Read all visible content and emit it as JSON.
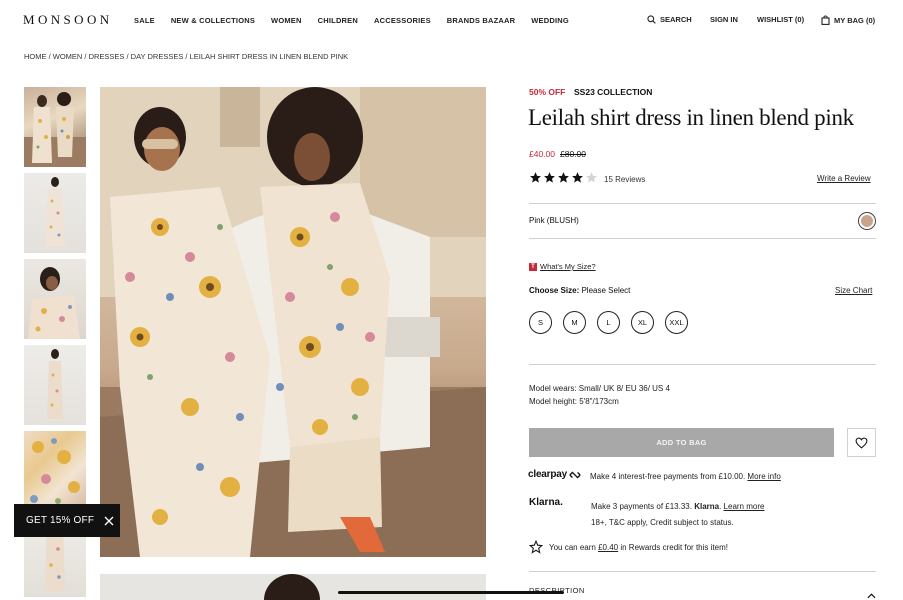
{
  "header": {
    "logo": "MONSOON",
    "nav": [
      "SALE",
      "NEW & COLLECTIONS",
      "WOMEN",
      "CHILDREN",
      "ACCESSORIES",
      "BRANDS BAZAAR",
      "WEDDING"
    ],
    "search": "SEARCH",
    "sign_in": "SIGN IN",
    "wishlist": "WISHLIST (0)",
    "bag": "MY BAG (0)"
  },
  "breadcrumb": "HOME / WOMEN / DRESSES / DAY DRESSES / LEILAH SHIRT DRESS IN LINEN BLEND PINK",
  "product": {
    "discount": "50% OFF",
    "collection": "SS23 COLLECTION",
    "title": "Leilah shirt dress in linen blend pink",
    "price_now": "£40.00",
    "price_was": "£80.00",
    "rating": 4,
    "rating_max": 5,
    "reviews": "15 Reviews",
    "write_review": "Write a Review",
    "color_label": "Pink (BLUSH)",
    "swatch_color": "#c9a48b",
    "whats_my_size": "What's My Size?",
    "size_badge": "T",
    "choose_size_label": "Choose Size:",
    "choose_size_value": "Please Select",
    "size_chart": "Size Chart",
    "sizes": [
      "S",
      "M",
      "L",
      "XL",
      "XXL"
    ],
    "model_wears": "Model wears: Small/ UK 8/ EU 36/ US 4",
    "model_height": "Model height: 5'8\"/173cm",
    "add_to_bag": "ADD TO BAG",
    "clearpay_logo": "clearpay",
    "clearpay_text": "Make 4 interest-free payments from £10.00.",
    "clearpay_more": "More info",
    "klarna_logo": "Klarna.",
    "klarna_text_1": "Make 3 payments of £13.33.",
    "klarna_brand": "Klarna",
    "klarna_learn": "Learn more",
    "klarna_text_2": "18+, T&C apply, Credit subject to status.",
    "rewards_pre": "You can earn",
    "rewards_amount": "£0.40",
    "rewards_post": "in Rewards credit for this item!",
    "description": "DESCRIPTION"
  },
  "promo": {
    "label": "GET 15% OFF"
  },
  "colors": {
    "accent_red": "#c8283c",
    "button_grey": "#a8a8a8"
  }
}
